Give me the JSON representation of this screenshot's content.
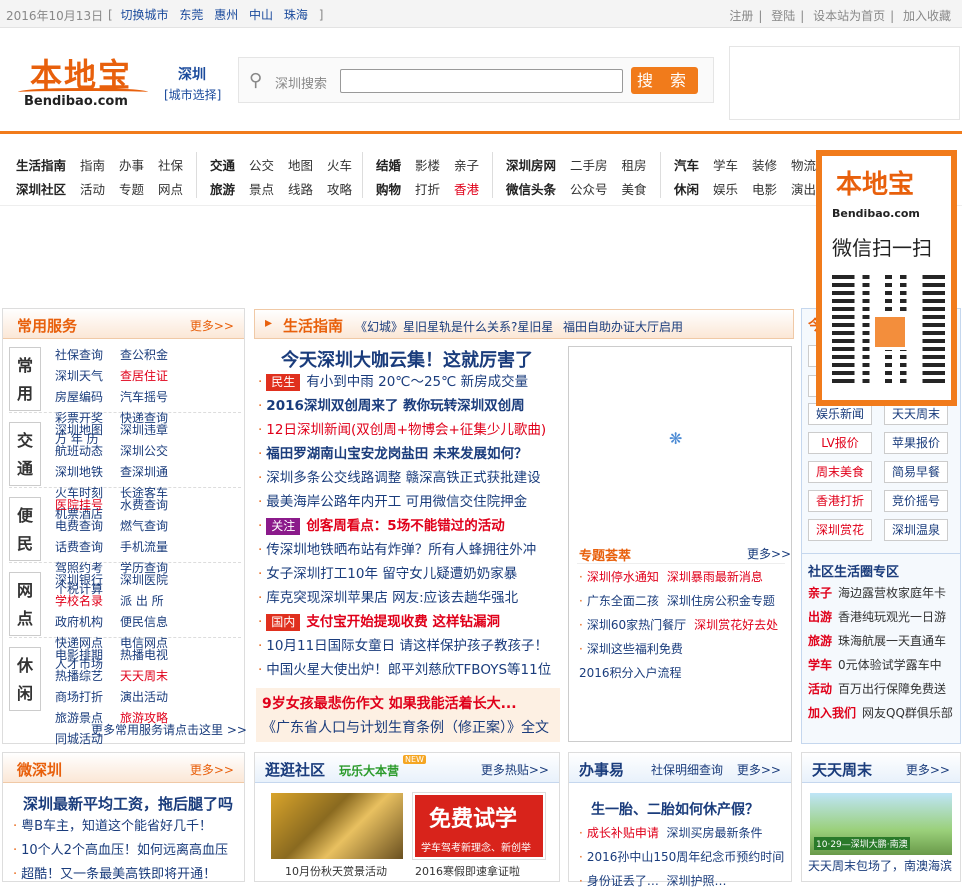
{
  "topbar": {
    "date": "2016年10月13日",
    "bracket_open": "[",
    "switch_city": "切换城市",
    "cities": [
      "东莞",
      "惠州",
      "中山",
      "珠海"
    ],
    "bracket_close": "]",
    "right_links": [
      "注册",
      "登陆",
      "设本站为首页",
      "加入收藏"
    ]
  },
  "header": {
    "logo_cn": "本地宝",
    "logo_en": "Bendibao.com",
    "city": "深圳",
    "city_select": "[城市选择]",
    "search_label": "深圳搜索",
    "search_value": "",
    "search_button": "搜 索"
  },
  "nav": {
    "groups": [
      {
        "row1": [
          "生活指南",
          "指南",
          "办事",
          "社保"
        ],
        "row2": [
          "深圳社区",
          "活动",
          "专题",
          "网点"
        ],
        "hl": []
      },
      {
        "row1": [
          "交通",
          "公交",
          "地图",
          "火车"
        ],
        "row2": [
          "旅游",
          "景点",
          "线路",
          "攻略"
        ],
        "hl": []
      },
      {
        "row1": [
          "结婚",
          "影楼",
          "亲子"
        ],
        "row2": [
          "购物",
          "打折",
          "香港"
        ],
        "hl": [
          "香港"
        ]
      },
      {
        "row1": [
          "深圳房网",
          "二手房",
          "租房"
        ],
        "row2": [
          "微信头条",
          "公众号",
          "美食"
        ],
        "hl": []
      },
      {
        "row1": [
          "汽车",
          "学车",
          "装修",
          "物流"
        ],
        "row2": [
          "休闲",
          "娱乐",
          "电影",
          "演出"
        ],
        "hl": []
      }
    ]
  },
  "qr_popup": {
    "logo_cn": "本地宝",
    "logo_en": "Bendibao.com",
    "text": "微信扫一扫"
  },
  "services": {
    "title": "常用服务",
    "more": "更多>>",
    "groups": [
      {
        "cat": [
          "常",
          "用"
        ],
        "items": [
          "社保查询",
          "查公积金",
          "深圳天气",
          "查居住证",
          "房屋编码",
          "汽车摇号",
          "彩票开奖",
          "快递查询",
          "万 年 历"
        ],
        "red": [
          "查居住证"
        ]
      },
      {
        "cat": [
          "交",
          "通"
        ],
        "items": [
          "深圳地图",
          "深圳违章",
          "航班动态",
          "深圳公交",
          "深圳地铁",
          "查深圳通",
          "火车时刻",
          "长途客车",
          "机票酒店"
        ],
        "red": []
      },
      {
        "cat": [
          "便",
          "民"
        ],
        "items": [
          "医院挂号",
          "水费查询",
          "电费查询",
          "燃气查询",
          "话费查询",
          "手机流量",
          "驾照约考",
          "学历查询",
          "个税计算"
        ],
        "red": [
          "医院挂号"
        ]
      },
      {
        "cat": [
          "网",
          "点"
        ],
        "items": [
          "深圳银行",
          "深圳医院",
          "学校名录",
          "派 出 所",
          "政府机构",
          "便民信息",
          "快递网点",
          "电信网点",
          "人才市场"
        ],
        "red": [
          "学校名录"
        ]
      },
      {
        "cat": [
          "休",
          "闲"
        ],
        "items": [
          "电影排期",
          "热播电视",
          "热播综艺",
          "天天周末",
          "商场打折",
          "演出活动",
          "旅游景点",
          "旅游攻略",
          "同城活动"
        ],
        "red": [
          "天天周末",
          "旅游攻略"
        ]
      }
    ],
    "footer": "更多常用服务请点击这里 >>"
  },
  "guide": {
    "title": "生活指南",
    "links": [
      "《幻城》星旧星轨是什么关系?星旧星",
      "福田自助办证大厅启用"
    ],
    "headline": "今天深圳大咖云集！这就厉害了",
    "items": [
      {
        "tag": "民生",
        "tag_color": "#e0301e",
        "text": "有小到中雨 20℃～25℃ 新房成交量",
        "style": "blue"
      },
      {
        "tag": "",
        "text": "2016深圳双创周来了 教你玩转深圳双创周",
        "style": "bold-blue"
      },
      {
        "tag": "",
        "text": "12日深圳新闻(双创周+物博会+征集少儿歌曲)",
        "style": "red"
      },
      {
        "tag": "",
        "text": "福田罗湖南山宝安龙岗盐田 未来发展如何？",
        "style": "bold-blue"
      },
      {
        "tag": "",
        "text": "深圳多条公交线路调整 赣深高铁正式获批建设",
        "style": "blue"
      },
      {
        "tag": "",
        "text": "最美海岸公路年内开工 可用微信交住院押金",
        "style": "blue"
      },
      {
        "tag": "关注",
        "tag_color": "#8b1a8b",
        "text": "创客周看点：5场不能错过的活动",
        "style": "bold-red"
      },
      {
        "tag": "",
        "text": "传深圳地铁晒布站有炸弹？所有人蜂拥往外冲",
        "style": "blue"
      },
      {
        "tag": "",
        "text": "女子深圳打工10年 留守女儿疑遭奶奶家暴",
        "style": "blue"
      },
      {
        "tag": "",
        "text": "库克突现深圳苹果店 网友:应该去趟华强北",
        "style": "blue"
      },
      {
        "tag": "国内",
        "tag_color": "#e0301e",
        "text": "支付宝开始提现收费 这样钻漏洞",
        "style": "bold-red"
      },
      {
        "tag": "",
        "text": "10月11日国际女童日 请这样保护孩子教孩子！",
        "style": "blue"
      },
      {
        "tag": "",
        "text": "中国火星大使出炉！郎平刘慈欣TFBOYS等11位",
        "style": "blue"
      }
    ],
    "essay_title": "9岁女孩最悲伤作文 如果我能活着长大...",
    "essay_sub": "《广东省人口与计划生育条例（修正案）》全文"
  },
  "topics": {
    "title": "专题荟萃",
    "more": "更多>>",
    "rows": [
      [
        "深圳停水通知",
        "深圳暴雨最新消息"
      ],
      [
        "广东全面二孩",
        "深圳住房公积金专题"
      ],
      [
        "深圳60家热门餐厅",
        "深圳赏花好去处"
      ],
      [
        "深圳这些福利免费",
        "2016积分入户流程"
      ]
    ]
  },
  "right_col": {
    "title_partial": "今",
    "buttons": [
      "娱乐新闻",
      "天天周末",
      "LV报价",
      "苹果报价",
      "周末美食",
      "简易早餐",
      "香港打折",
      "竞价摇号",
      "深圳赏花",
      "深圳温泉"
    ],
    "community_title": "社区生活圈专区",
    "community": [
      {
        "k": "亲子",
        "v": "海边露营",
        "v2": "枚家庭年卡"
      },
      {
        "k": "出游",
        "v": "香港纯玩观光一日游",
        "v2": ""
      },
      {
        "k": "旅游",
        "v": "珠海航展一天直通车",
        "v2": ""
      },
      {
        "k": "学车",
        "v": "0元体验试学露车中",
        "v2": ""
      },
      {
        "k": "活动",
        "v": "百万出行保障免费送",
        "v2": ""
      },
      {
        "k": "加入我们",
        "v": "网友QQ群俱乐部",
        "v2": ""
      }
    ]
  },
  "bottom": {
    "weishenzhen": {
      "title": "微深圳",
      "more": "更多>>",
      "headline": "深圳最新平均工资，拖后腿了吗",
      "items": [
        "粤B车主，知道这个能省好几千！",
        "10个人2个高血压！如何远离高血压",
        "超酷！又一条最美高铁即将开通！"
      ]
    },
    "community": {
      "title": "逛逛社区",
      "sub": "玩乐大本营",
      "badge": "NEW",
      "more": "更多热贴>>",
      "img1_caption": "10月份秋天赏景活动",
      "img2_text": "免费试学",
      "img2_sub": "学车驾考新理念、新创举",
      "img2_caption": "2016寒假即速拿证啦"
    },
    "banshiyi": {
      "title": "办事易",
      "sub": "社保明细查询",
      "more": "更多>>",
      "headline": "生一胎、二胎如何休产假？",
      "items": [
        [
          "成长补贴申请",
          "深圳买房最新条件"
        ],
        [
          "2016孙中山150周年纪念币预约时间"
        ],
        [
          "身份证丢了…",
          "深圳护照…"
        ]
      ]
    },
    "weekend": {
      "title": "天天周末",
      "more": "更多>>",
      "img_text": "10·29—深圳大鹏·南澳",
      "caption": "天天周末包场了，南澳海滨"
    }
  }
}
